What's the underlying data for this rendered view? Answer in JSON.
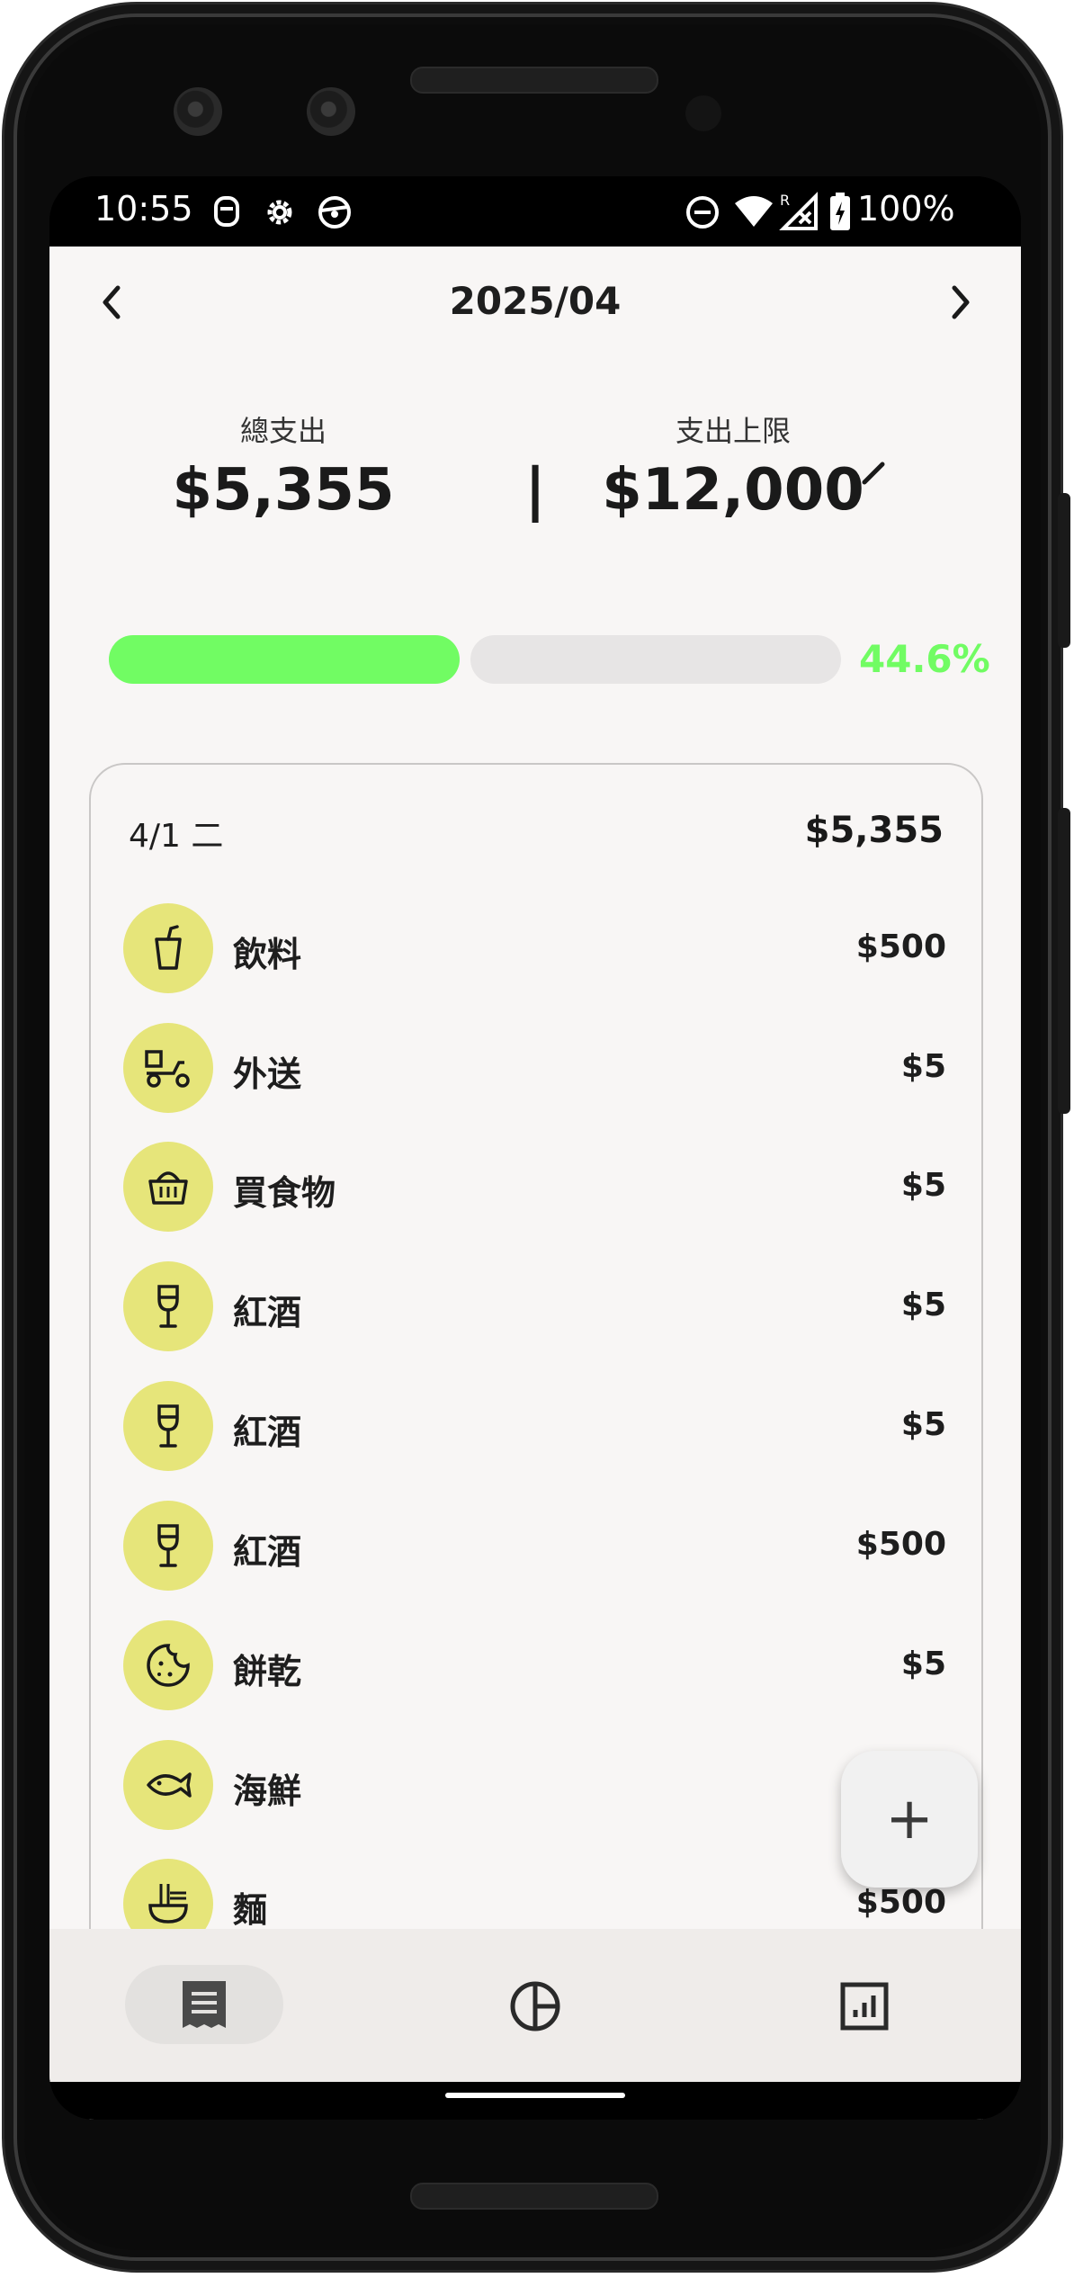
{
  "status_bar": {
    "time": "10:55",
    "battery": "100%",
    "icons": [
      "notification-icon",
      "settings-icon",
      "steering-icon",
      "do-not-disturb-icon",
      "wifi-icon",
      "signal-icon",
      "battery-charging-icon"
    ]
  },
  "header": {
    "month": "2025/04",
    "prev_icon": "chevron-left-icon",
    "next_icon": "chevron-right-icon"
  },
  "summary": {
    "total_label": "總支出",
    "total_value": "$5,355",
    "divider": "|",
    "limit_label": "支出上限",
    "limit_value": "$12,000",
    "edit_icon": "pencil-icon"
  },
  "progress": {
    "percent_text": "44.6%",
    "fraction": 0.446,
    "fill_color": "#71fc63",
    "track_color": "#e7e5e5"
  },
  "day_card": {
    "date": "4/1 二",
    "total": "$5,355",
    "items": [
      {
        "label": "飲料",
        "amount": "$500",
        "icon": "drink-cup-icon"
      },
      {
        "label": "外送",
        "amount": "$5",
        "icon": "delivery-scooter-icon"
      },
      {
        "label": "買食物",
        "amount": "$5",
        "icon": "basket-icon"
      },
      {
        "label": "紅酒",
        "amount": "$5",
        "icon": "wine-glass-icon"
      },
      {
        "label": "紅酒",
        "amount": "$5",
        "icon": "wine-glass-icon"
      },
      {
        "label": "紅酒",
        "amount": "$500",
        "icon": "wine-glass-icon"
      },
      {
        "label": "餅乾",
        "amount": "$5",
        "icon": "cookie-icon"
      },
      {
        "label": "海鮮",
        "amount": "",
        "icon": "fish-icon"
      },
      {
        "label": "麵",
        "amount": "$500",
        "icon": "noodle-bowl-icon"
      }
    ]
  },
  "fab": {
    "label": "+",
    "icon": "plus-icon"
  },
  "bottom_nav": {
    "items": [
      {
        "name": "receipt",
        "icon": "receipt-icon",
        "active": true
      },
      {
        "name": "pie-chart",
        "icon": "pie-chart-icon",
        "active": false
      },
      {
        "name": "bar-chart",
        "icon": "bar-chart-icon",
        "active": false
      }
    ]
  },
  "colors": {
    "accent_green": "#71fc63",
    "icon_circle": "#e6e57a",
    "background": "#f8f6f5"
  }
}
